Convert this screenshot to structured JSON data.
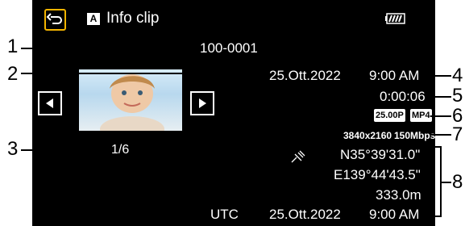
{
  "header": {
    "mode_badge": "A",
    "title": "Info clip"
  },
  "clip": {
    "number": "100-0001",
    "recording_date": "25.Ott.2022",
    "recording_time": "9:00 AM",
    "duration": "0:00:06",
    "frame_rate_badge": "25.00P",
    "format_badge": "MP4",
    "resolution": "3840x2160",
    "bitrate": "150Mbps",
    "index": "1/6"
  },
  "gps": {
    "latitude": "N35°39'31.0\"",
    "longitude": "E139°44'43.5\"",
    "altitude": "333.0m",
    "utc_label": "UTC",
    "utc_date": "25.Ott.2022",
    "utc_time": "9:00 AM"
  },
  "callouts": [
    "1",
    "2",
    "3",
    "4",
    "5",
    "6",
    "7",
    "8"
  ],
  "icons": {
    "back": "back-arrow-icon",
    "battery": "battery-icon",
    "gps": "satellite-icon",
    "prev": "previous-triangle-icon",
    "next": "next-triangle-icon"
  },
  "colors": {
    "accent": "#f4b400",
    "screen_bg": "#000000",
    "text": "#ffffff"
  }
}
